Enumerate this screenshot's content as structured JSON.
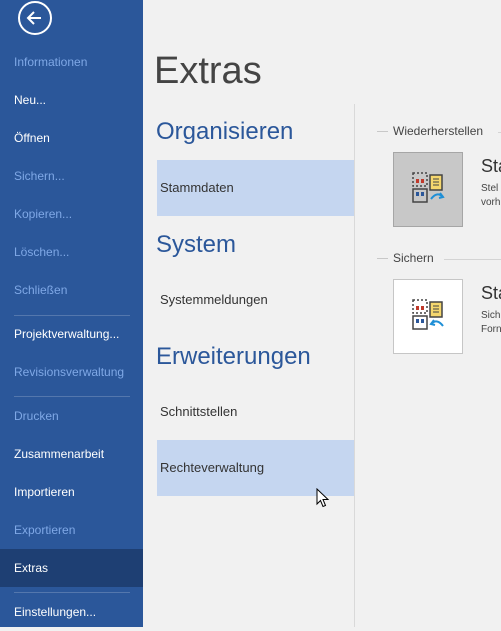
{
  "sidebar": {
    "back_icon": "back-arrow-icon",
    "items": [
      {
        "label": "Informationen"
      },
      {
        "label": "Neu..."
      },
      {
        "label": "Öffnen"
      },
      {
        "label": "Sichern..."
      },
      {
        "label": "Kopieren..."
      },
      {
        "label": "Löschen..."
      },
      {
        "label": "Schließen"
      },
      {
        "label": "Projektverwaltung..."
      },
      {
        "label": "Revisionsverwaltung"
      },
      {
        "label": "Drucken"
      },
      {
        "label": "Zusammenarbeit"
      },
      {
        "label": "Importieren"
      },
      {
        "label": "Exportieren"
      },
      {
        "label": "Extras"
      },
      {
        "label": "Einstellungen..."
      }
    ],
    "active_item": "Extras",
    "disabled_items": [
      "Informationen",
      "Sichern...",
      "Kopieren...",
      "Löschen...",
      "Schließen",
      "Revisionsverwaltung",
      "Drucken",
      "Exportieren"
    ]
  },
  "main": {
    "title": "Extras",
    "sections": [
      {
        "heading": "Organisieren",
        "items": [
          {
            "label": "Stammdaten"
          }
        ]
      },
      {
        "heading": "System",
        "items": [
          {
            "label": "Systemmeldungen"
          }
        ]
      },
      {
        "heading": "Erweiterungen",
        "items": [
          {
            "label": "Schnittstellen"
          },
          {
            "label": "Rechteverwaltung"
          }
        ]
      }
    ],
    "selected_item": "Stammdaten",
    "hovered_item": "Rechteverwaltung"
  },
  "detail": {
    "groups": [
      {
        "label": "Wiederherstellen",
        "action_title": "Sta",
        "action_desc": [
          "Stel",
          "vorh"
        ],
        "icon": "restore-database-icon"
      },
      {
        "label": "Sichern",
        "action_title": "Sta",
        "action_desc": [
          "Sich",
          "Forn"
        ],
        "icon": "backup-database-icon"
      }
    ]
  },
  "colors": {
    "sidebar_bg": "#2b579a",
    "sidebar_active": "#1e3f73",
    "sidebar_disabled_text": "#7fa8e6",
    "accent": "#2b579a",
    "selection_bg": "#c5d6f0",
    "page_bg": "#f1f1f1"
  }
}
